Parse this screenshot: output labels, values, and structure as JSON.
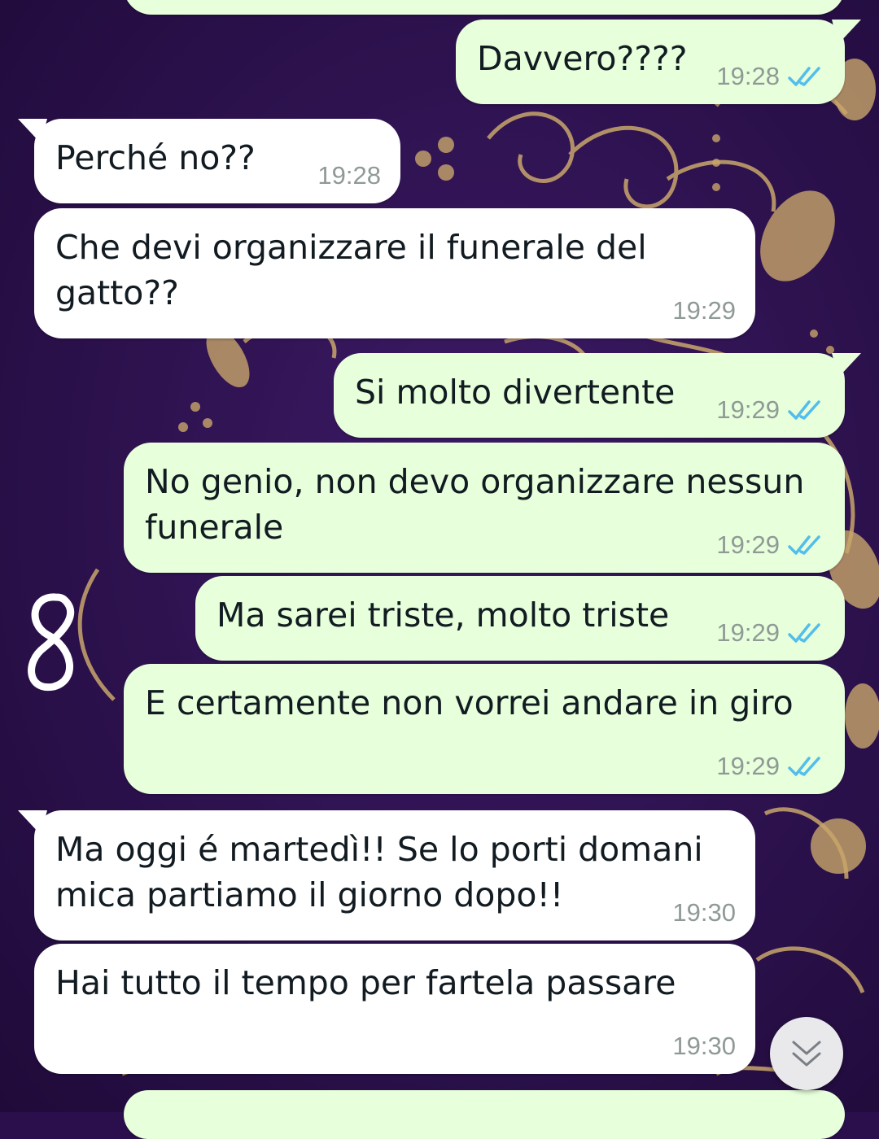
{
  "chat": {
    "messages": [
      {
        "direction": "outgoing",
        "text": "Davvero????",
        "time": "19:28",
        "status": "read"
      },
      {
        "direction": "incoming",
        "text": "Perché no??",
        "time": "19:28"
      },
      {
        "direction": "incoming",
        "text": "Che devi organizzare il funerale del\ngatto??",
        "time": "19:29"
      },
      {
        "direction": "outgoing",
        "text": "Si molto divertente",
        "time": "19:29",
        "status": "read"
      },
      {
        "direction": "outgoing",
        "text": "No genio, non devo organizzare nessun\nfunerale",
        "time": "19:29",
        "status": "read"
      },
      {
        "direction": "outgoing",
        "text": "Ma sarei triste, molto triste",
        "time": "19:29",
        "status": "read"
      },
      {
        "direction": "outgoing",
        "text": "E certamente non vorrei andare in giro",
        "time": "19:29",
        "status": "read"
      },
      {
        "direction": "incoming",
        "text": "Ma oggi é martedì!! Se lo porti domani\nmica partiamo il giorno dopo!!",
        "time": "19:30"
      },
      {
        "direction": "incoming",
        "text": "Hai tutto il tempo per fartela passare",
        "time": "19:30"
      }
    ]
  },
  "icons": {
    "read_ticks": "double-check-icon",
    "scroll_down": "double-chevron-down-icon",
    "doodle": "handwritten-8-doodle"
  },
  "colors": {
    "outgoing_bubble": "#e7ffdb",
    "incoming_bubble": "#ffffff",
    "read_tick": "#53bdeb",
    "wallpaper": "#2a0f4c",
    "wallpaper_ornament": "#c9a66b"
  }
}
